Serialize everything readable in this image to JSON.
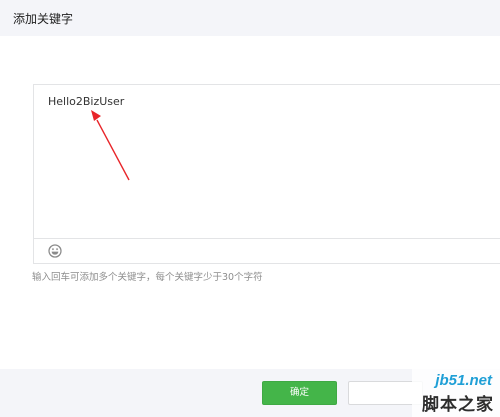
{
  "dialog": {
    "title": "添加关键字"
  },
  "editor": {
    "value": "Hello2BizUser",
    "toolbar": {
      "emoji_icon": "emoji-smiley-icon"
    }
  },
  "hint": "输入回车可添加多个关键字，每个关键字少于30个字符",
  "footer": {
    "ok_label": "确定",
    "cancel_label": ""
  },
  "annotation": {
    "arrow_color": "#e8252a"
  },
  "watermark": {
    "url": "jb51.net",
    "site": "脚本之家"
  },
  "colors": {
    "accent": "#44b549",
    "header_bg": "#f4f5f9"
  }
}
